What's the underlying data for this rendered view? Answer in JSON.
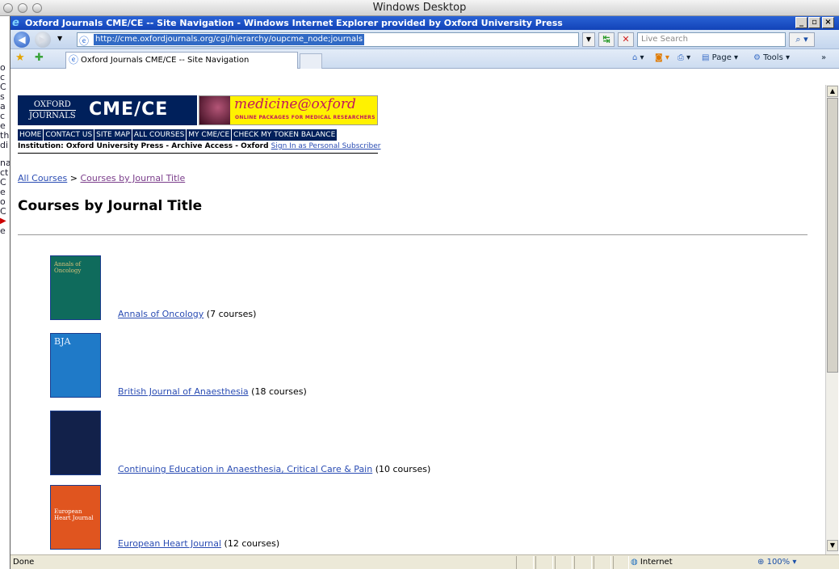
{
  "desktop": {
    "mac_title": "Windows Desktop"
  },
  "browser": {
    "window_title": "Oxford Journals CME/CE -- Site Navigation - Windows Internet Explorer provided by Oxford University Press",
    "url": "http://cme.oxfordjournals.org/cgi/hierarchy/oupcme_node;journals",
    "search_placeholder": "Live Search",
    "tab_title": "Oxford Journals CME/CE -- Site Navigation",
    "commands": {
      "page": "Page",
      "tools": "Tools",
      "more": "»"
    },
    "status": {
      "text": "Done",
      "zone": "Internet",
      "zoom": "100%"
    }
  },
  "site": {
    "logo_oxford_line1": "OXFORD",
    "logo_oxford_line2": "JOURNALS",
    "logo_cme": "CME/CE",
    "banner_title": "medicine@oxford",
    "banner_tagline": "ONLINE PACKAGES FOR MEDICAL RESEARCHERS",
    "nav": [
      "HOME",
      "CONTACT US",
      "SITE MAP",
      "ALL COURSES",
      "MY CME/CE",
      "CHECK MY TOKEN BALANCE"
    ],
    "institution_text": "Institution: Oxford University Press - Archive Access - Oxford",
    "sign_in_link": "Sign In as Personal Subscriber"
  },
  "breadcrumb": {
    "root": "All Courses",
    "separator": ">",
    "current": "Courses by Journal Title"
  },
  "page_title": "Courses by Journal Title",
  "journals": [
    {
      "title": "Annals of Oncology",
      "count": "(7 courses)",
      "cover_color": "#0f6b5c",
      "cover_text": "Annals of Oncology"
    },
    {
      "title": "British Journal of Anaesthesia",
      "count": "(18 courses)",
      "cover_color": "#1f7ac8",
      "cover_text": "BJA"
    },
    {
      "title": "Continuing Education in Anaesthesia, Critical Care & Pain",
      "count": "(10 courses)",
      "cover_color": "#12214a",
      "cover_text": ""
    },
    {
      "title": "European Heart Journal",
      "count": "(12 courses)",
      "cover_color": "#e0551f",
      "cover_text": "European Heart Journal"
    }
  ]
}
